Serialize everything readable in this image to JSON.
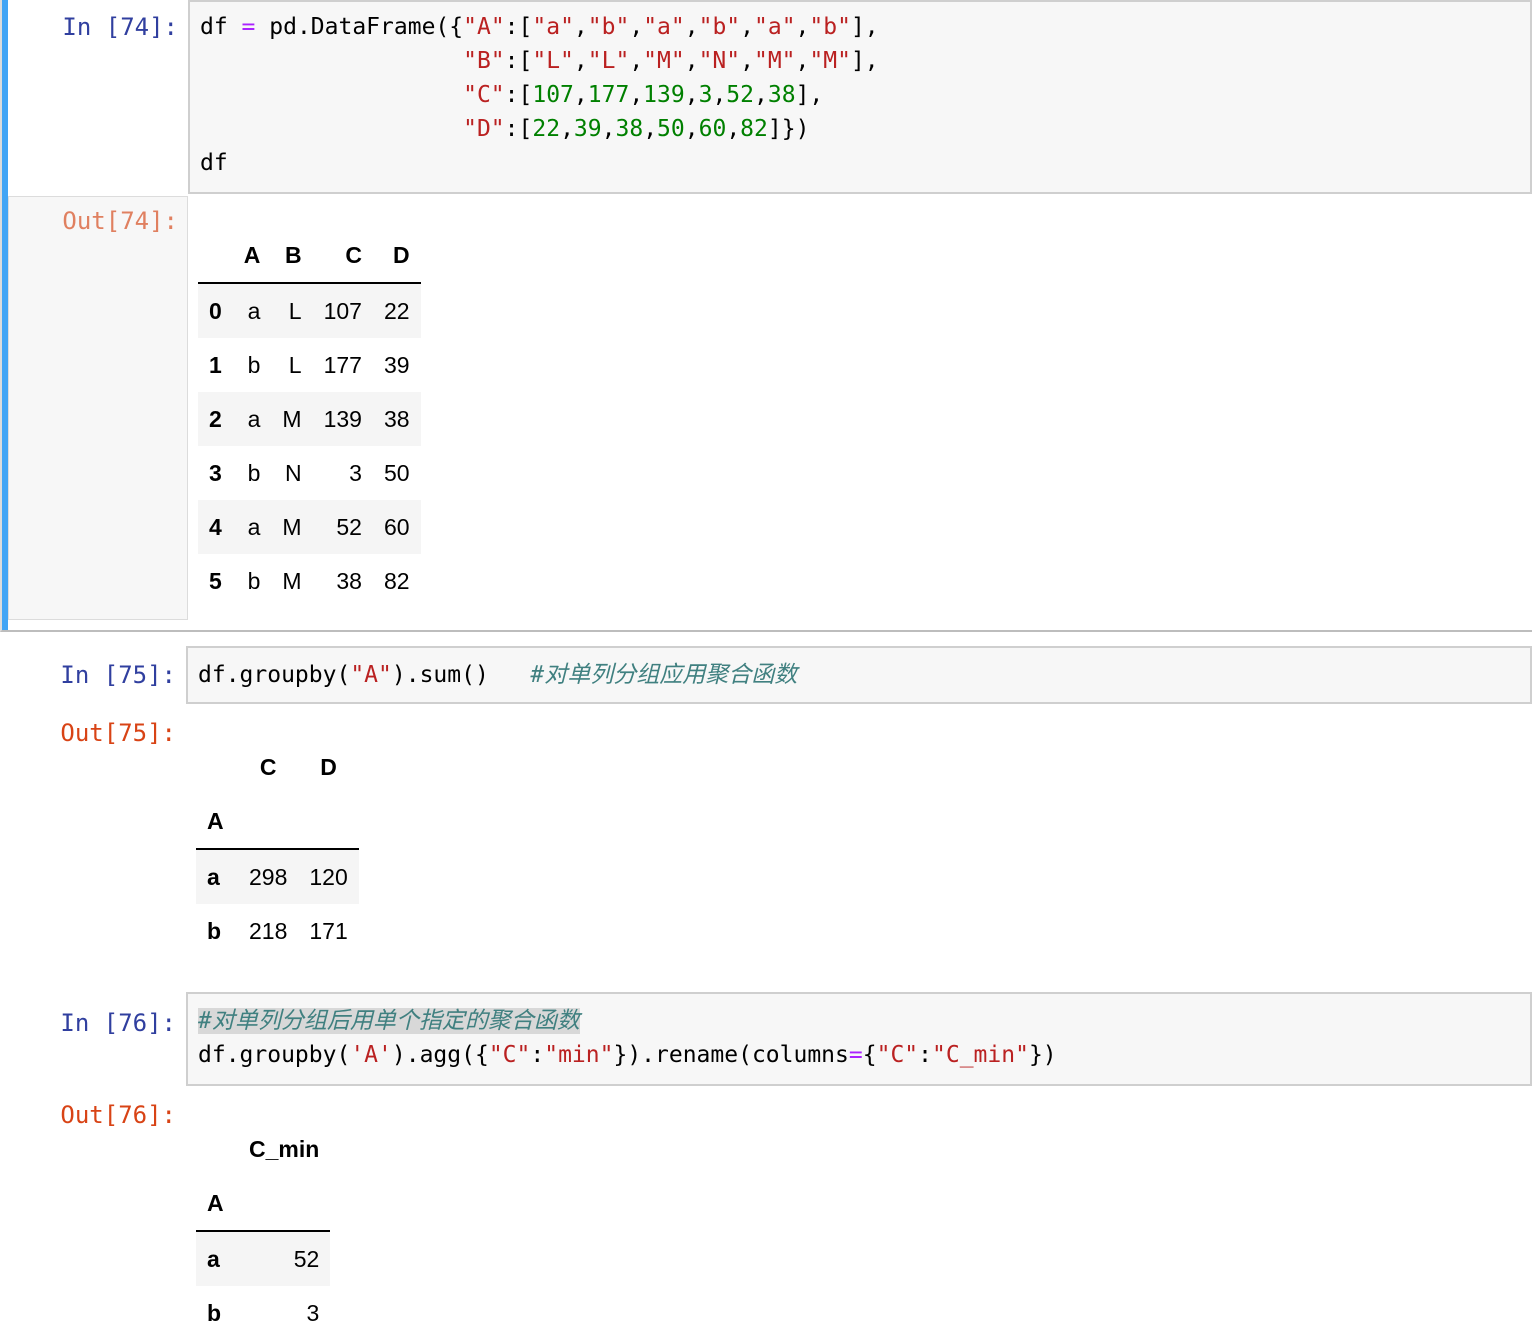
{
  "cells": [
    {
      "in_prompt": "In  [74]:",
      "out_prompt": "Out[74]:",
      "code_lines": [
        "df = pd.DataFrame({\"A\":[\"a\",\"b\",\"a\",\"b\",\"a\",\"b\"],",
        "                   \"B\":[\"L\",\"L\",\"M\",\"N\",\"M\",\"M\"],",
        "                   \"C\":[107,177,139,3,52,38],",
        "                   \"D\":[22,39,38,50,60,82]})",
        "df"
      ],
      "output_table": {
        "columns": [
          "",
          "A",
          "B",
          "C",
          "D"
        ],
        "rows": [
          [
            "0",
            "a",
            "L",
            "107",
            "22"
          ],
          [
            "1",
            "b",
            "L",
            "177",
            "39"
          ],
          [
            "2",
            "a",
            "M",
            "139",
            "38"
          ],
          [
            "3",
            "b",
            "N",
            "3",
            "50"
          ],
          [
            "4",
            "a",
            "M",
            "52",
            "60"
          ],
          [
            "5",
            "b",
            "M",
            "38",
            "82"
          ]
        ]
      }
    },
    {
      "in_prompt": "In  [75]:",
      "out_prompt": "Out[75]:",
      "code_parts": {
        "pre": "df.groupby(",
        "arg": "\"A\"",
        "post": ").sum()   ",
        "comment": "#对单列分组应用聚合函数"
      },
      "output_table": {
        "columns": [
          "",
          "C",
          "D"
        ],
        "index_name": "A",
        "rows": [
          [
            "a",
            "298",
            "120"
          ],
          [
            "b",
            "218",
            "171"
          ]
        ]
      }
    },
    {
      "in_prompt": "In  [76]:",
      "out_prompt": "Out[76]:",
      "comment": "#对单列分组后用单个指定的聚合函数",
      "code_line2": "df.groupby('A').agg({\"C\":\"min\"}).rename(columns={\"C\":\"C_min\"})",
      "output_table": {
        "columns": [
          "",
          "C_min"
        ],
        "index_name": "A",
        "rows": [
          [
            "a",
            "52"
          ],
          [
            "b",
            "3"
          ]
        ]
      }
    }
  ]
}
